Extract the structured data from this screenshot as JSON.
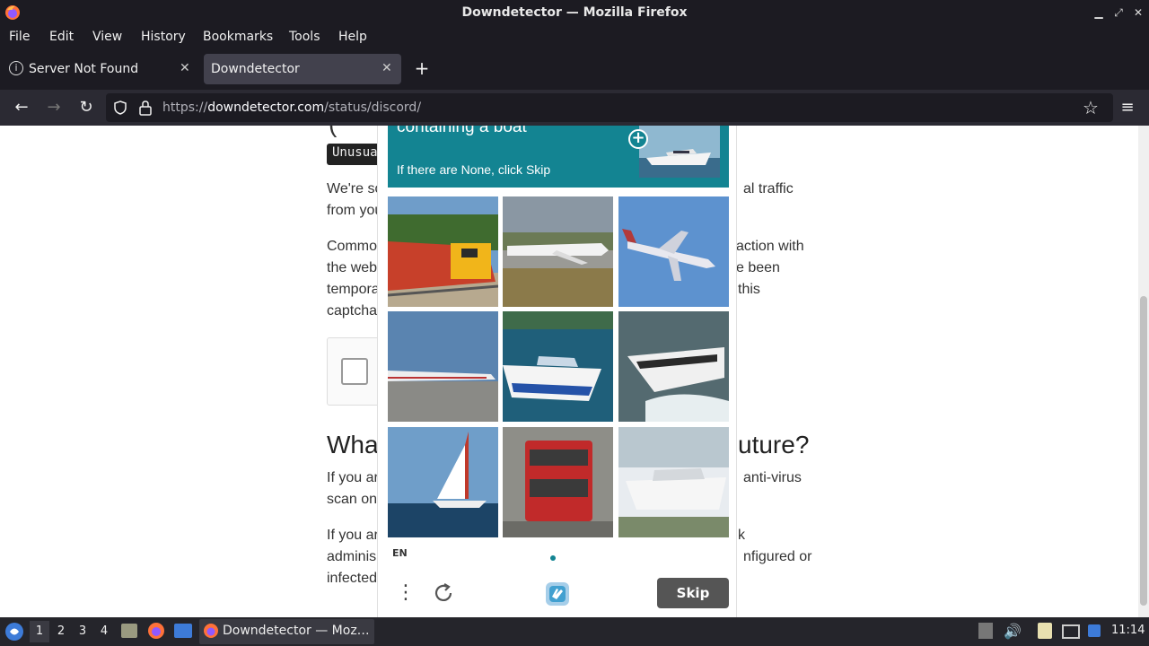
{
  "window": {
    "title": "Downdetector — Mozilla Firefox"
  },
  "menu": [
    "File",
    "Edit",
    "View",
    "History",
    "Bookmarks",
    "Tools",
    "Help"
  ],
  "tabs": [
    {
      "label": "Server Not Found",
      "active": false
    },
    {
      "label": "Downdetector",
      "active": true
    }
  ],
  "nav": {
    "url_prefix": "https://",
    "url_domain": "downdetector.com",
    "url_path": "/status/discord/"
  },
  "page": {
    "badge": "Unusua",
    "p1_left": [
      "We're so",
      "from you"
    ],
    "p1_right": [
      "al traffic"
    ],
    "p2_left": [
      "Commo",
      "the web",
      "tempora",
      "captcha"
    ],
    "p2_right": [
      "action with",
      "e been",
      "this"
    ],
    "heading_left": "Wha",
    "heading_right": "uture?",
    "p3_left": [
      "If you ar",
      "scan on"
    ],
    "p3_right": [
      "anti-virus"
    ],
    "p4_left": [
      "If you ar",
      "adminis",
      "infected"
    ],
    "p4_right": [
      "k",
      "nfigured or"
    ]
  },
  "challenge": {
    "prompt_title": "containing a boat",
    "prompt_sub": "If there are None, click Skip",
    "tiles": [
      "train",
      "airplane-ground",
      "airplane-flying",
      "airplane-runway",
      "speedboat-blue",
      "speedboat-wake",
      "sailboat",
      "double-decker-bus",
      "boat-trailer"
    ],
    "lang": "EN",
    "skip_label": "Skip",
    "accent": "#138492"
  },
  "taskbar": {
    "workspaces": [
      "1",
      "2",
      "3",
      "4"
    ],
    "task_label": "Downdetector — Moz…",
    "clock": "11:14"
  }
}
